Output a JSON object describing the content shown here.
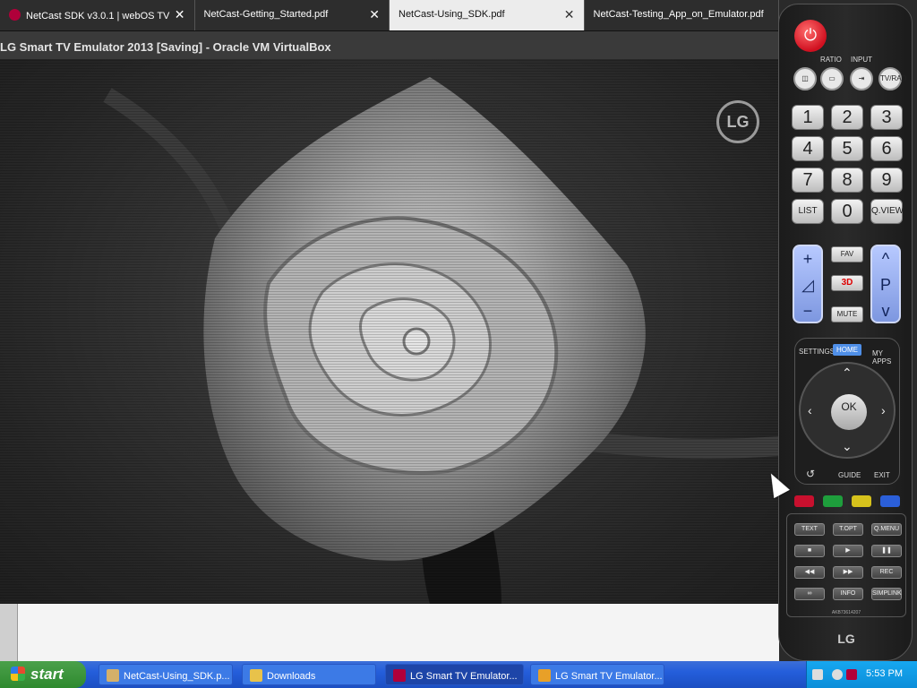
{
  "tabs": [
    {
      "label": "NetCast SDK v3.0.1 | webOS TV",
      "active": false
    },
    {
      "label": "NetCast-Getting_Started.pdf",
      "active": false
    },
    {
      "label": "NetCast-Using_SDK.pdf",
      "active": true
    },
    {
      "label": "NetCast-Testing_App_on_Emulator.pdf",
      "active": false
    }
  ],
  "vm_window": {
    "title": "LG Smart TV Emulator 2013 [Saving] - Oracle VM VirtualBox"
  },
  "tv_screen": {
    "logo_text": "LG"
  },
  "remote": {
    "labels": {
      "ratio": "RATIO",
      "input": "INPUT",
      "tvrad": "TV/RAD"
    },
    "numbers": [
      "1",
      "2",
      "3",
      "4",
      "5",
      "6",
      "7",
      "8",
      "9"
    ],
    "list": "LIST",
    "zero": "0",
    "qview": "Q.VIEW",
    "fav": "FAV",
    "three_d": "3D",
    "mute": "MUTE",
    "vol_plus": "+",
    "vol_minus": "−",
    "ch_up": "^",
    "p": "P",
    "ch_down": "v",
    "settings": "SETTINGS",
    "home": "HOME",
    "myapps": "MY APPS",
    "ok": "OK",
    "guide": "GUIDE",
    "exit": "EXIT",
    "back": "↺",
    "text": "TEXT",
    "topt": "T.OPT",
    "qmenu": "Q.MENU",
    "stop": "■",
    "play": "▶",
    "pause": "❚❚",
    "rew": "◀◀",
    "ffwd": "▶▶",
    "rec": "REC",
    "loop": "∞",
    "info": "INFO",
    "simplink": "SIMPLINK",
    "model": "AKB73614207",
    "brand": "LG",
    "color_keys": [
      "#c8102e",
      "#1e9e3c",
      "#d6c21c",
      "#2b5fd9"
    ]
  },
  "taskbar": {
    "start": "start",
    "items": [
      {
        "label": "NetCast-Using_SDK.p...",
        "active": false
      },
      {
        "label": "Downloads",
        "active": false
      },
      {
        "label": "LG Smart TV Emulator...",
        "active": true
      },
      {
        "label": "LG Smart TV Emulator...",
        "active": false
      }
    ],
    "clock": "5:53 PM"
  }
}
